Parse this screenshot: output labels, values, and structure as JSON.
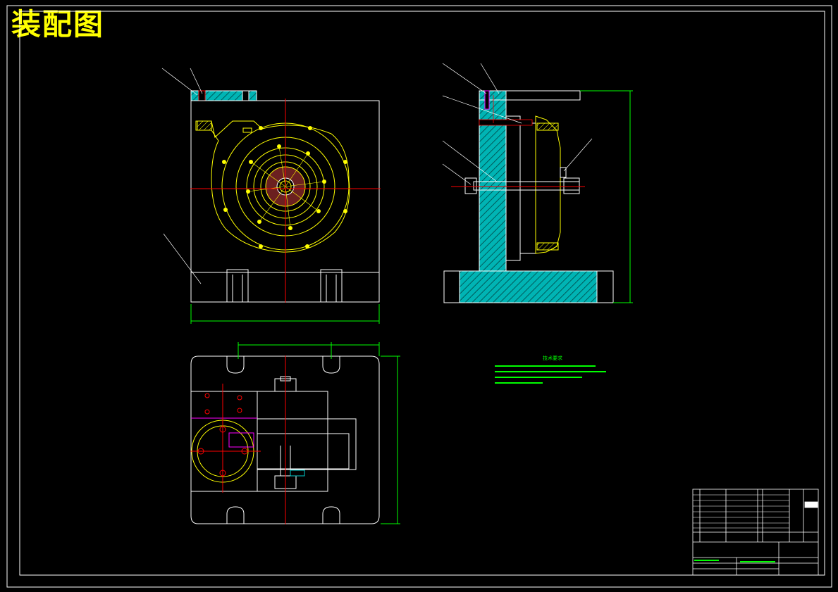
{
  "header": {
    "title": "装配图"
  },
  "notes": {
    "title": "技术要求"
  },
  "colors": {
    "background": "#000000",
    "outline": "#ffffff",
    "part": "#ffff00",
    "center_line": "#ff0000",
    "dimension": "#00ff00",
    "section_hatch": "#00c8c8",
    "accent": "#ff00ff"
  },
  "icons": [
    "drawing-frame",
    "front-view",
    "side-section-view",
    "top-view",
    "title-block"
  ]
}
